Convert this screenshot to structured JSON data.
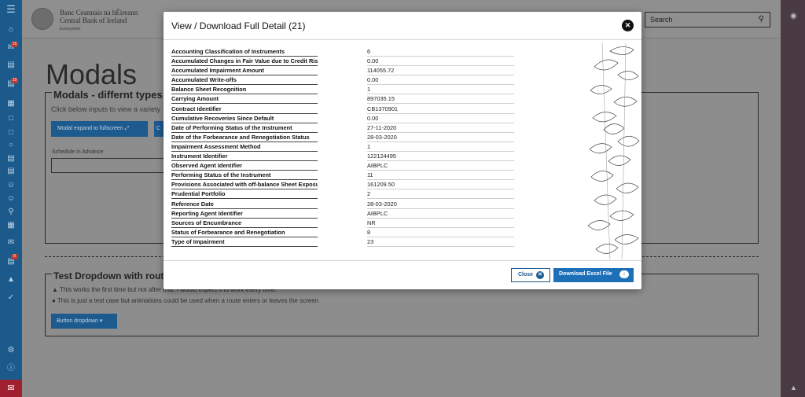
{
  "header": {
    "logo_line1": "Banc Ceannais na hÉireann",
    "logo_line2": "Central Bank of Ireland",
    "logo_line3": "Eurosystem",
    "search_placeholder": "Search"
  },
  "sidebar": {
    "badges": [
      "15",
      "19",
      "8"
    ]
  },
  "background_page": {
    "title": "Modals",
    "section1_title": "Modals - differnt types of mo",
    "section1_subtitle": "Click below inputs to view a variety",
    "button_fullscreen": "Modal expand to fullscreen",
    "button_partial": "C",
    "schedule_label": "Schedule in Advance",
    "section2_title": "Test Dropdown with router",
    "line1": "This works the first time but not after that. I would expect it to work every time.",
    "line2": "This is just a test case but animations could be used when a route enters or leaves the screen",
    "dropdown_button": "Button dropdown"
  },
  "modal": {
    "title": "View / Download Full Detail (21)",
    "rows": [
      {
        "label": "Accounting Classification of Instruments",
        "value": "6"
      },
      {
        "label": "Accumulated Changes in Fair Value due to Credit Risk",
        "value": "0.00"
      },
      {
        "label": "Accumulated Impairment Amount",
        "value": "114055.72"
      },
      {
        "label": "Accumulated Write-offs",
        "value": "0.00"
      },
      {
        "label": "Balance Sheet Recognition",
        "value": "1"
      },
      {
        "label": "Carrying Amount",
        "value": "897035.15"
      },
      {
        "label": "Contract Identifier",
        "value": "CB1370901"
      },
      {
        "label": "Cumulative Recoveries Since Default",
        "value": "0.00"
      },
      {
        "label": "Date of Performing Status of the Instrument",
        "value": "27-11-2020"
      },
      {
        "label": "Date of the Forbearance and Renegotiation Status",
        "value": "28-03-2020"
      },
      {
        "label": "Impairment Assessment Method",
        "value": "1"
      },
      {
        "label": "Instrument Identifier",
        "value": "122124495"
      },
      {
        "label": "Observed Agent Identifier",
        "value": "AIBPLC"
      },
      {
        "label": "Performing Status of the Instrument",
        "value": "11"
      },
      {
        "label": "Provisions Associated with off-balance Sheet Exposures",
        "value": "161209.50"
      },
      {
        "label": "Prudential Portfolio",
        "value": "2"
      },
      {
        "label": "Reference Date",
        "value": "28-03-2020"
      },
      {
        "label": "Reporting Agent Identifier",
        "value": "AIBPLC"
      },
      {
        "label": "Sources of Encumbrance",
        "value": "NR"
      },
      {
        "label": "Status of Forbearance and Renegotiation",
        "value": "8"
      },
      {
        "label": "Type of Impairment",
        "value": "23"
      }
    ],
    "close_label": "Close",
    "download_label": "Download Excel File"
  },
  "colors": {
    "primary": "#1d6fb8",
    "sidebar": "#1c5a8c",
    "alert": "#a02030"
  }
}
